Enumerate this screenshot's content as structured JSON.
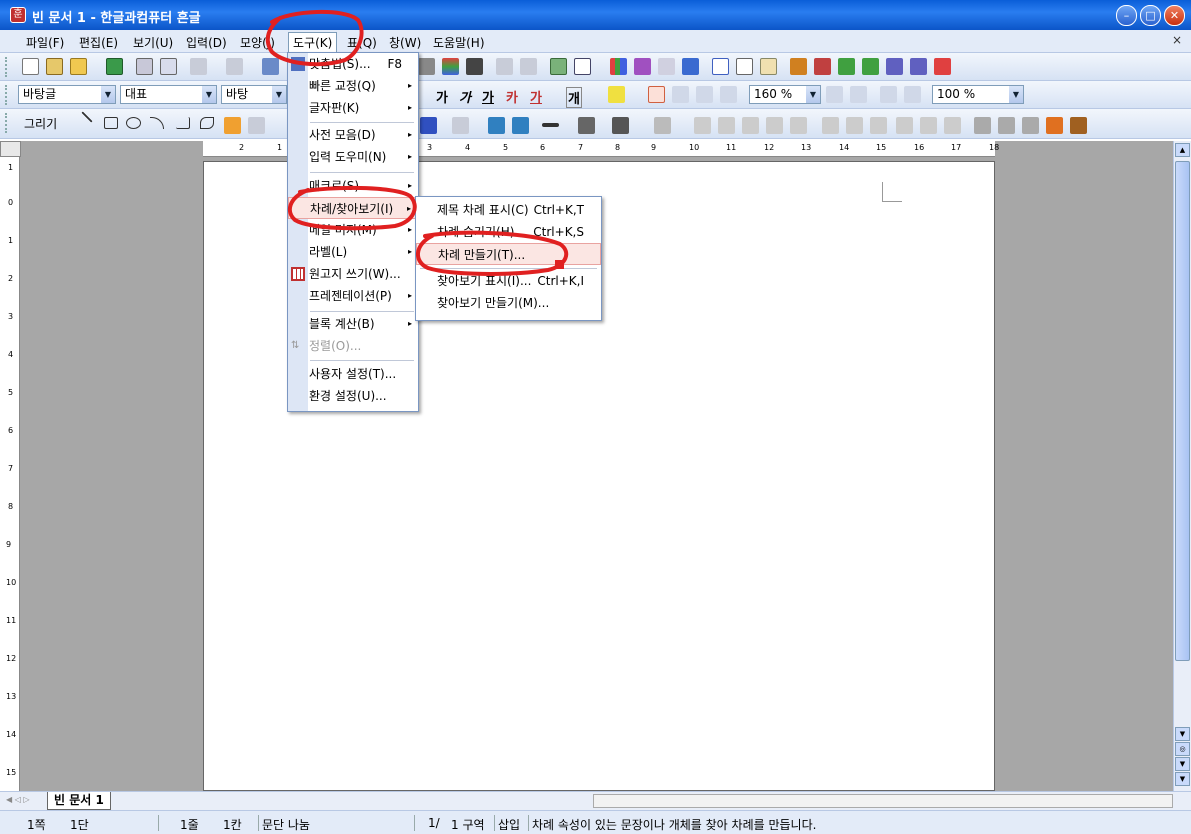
{
  "window": {
    "title": "빈 문서 1 - 한글과컴퓨터 흔글",
    "app_icon": "hancom-icon"
  },
  "menubar": {
    "items": [
      "파일(F)",
      "편집(E)",
      "보기(U)",
      "입력(D)",
      "모양(J)",
      "도구(K)",
      "표(Q)",
      "창(W)",
      "도움말(H)"
    ],
    "active": "도구(K)",
    "close": "×"
  },
  "toolbar2": {
    "style": "바탕글",
    "para": "대표",
    "font": "바탕",
    "line_spacing": "160 %",
    "zoom": "100 %"
  },
  "toolbar3": {
    "draw_label": "그리기"
  },
  "tools_menu": {
    "items": [
      {
        "label": "맞춤법(S)...",
        "shortcut": "F8"
      },
      {
        "label": "빠른 교정(Q)",
        "sub": "▸"
      },
      {
        "label": "글자판(K)",
        "sub": "▸"
      },
      {
        "label": "사전 모음(D)",
        "sub": "▸"
      },
      {
        "label": "입력 도우미(N)",
        "sub": "▸"
      },
      {
        "label": "매크로(S)",
        "sub": "▸"
      },
      {
        "label": "차례/찾아보기(I)",
        "sub": "▸"
      },
      {
        "label": "메일 머지(M)",
        "sub": "▸"
      },
      {
        "label": "라벨(L)",
        "sub": "▸"
      },
      {
        "label": "원고지 쓰기(W)..."
      },
      {
        "label": "프레젠테이션(P)",
        "sub": "▸"
      },
      {
        "label": "블록 계산(B)",
        "sub": "▸"
      },
      {
        "label": "정렬(O)...",
        "disabled": true
      },
      {
        "label": "사용자 설정(T)..."
      },
      {
        "label": "환경 설정(U)..."
      }
    ]
  },
  "sub_menu": {
    "items": [
      {
        "label": "제목 차례 표시(C)",
        "shortcut": "Ctrl+K,T"
      },
      {
        "label": "차례 숨기기(H)",
        "shortcut": "Ctrl+K,S"
      },
      {
        "label": "차례 만들기(T)...",
        "highlighted": true
      },
      {
        "label": "찾아보기 표시(I)...",
        "shortcut": "Ctrl+K,I"
      },
      {
        "label": "찾아보기 만들기(M)..."
      }
    ]
  },
  "tabs": {
    "doc_tab": "빈 문서 1"
  },
  "statusbar": {
    "page": "1쪽",
    "column": "1단",
    "line": "1줄",
    "char": "1칸",
    "break": "문단 나눔",
    "pages": "1/",
    "section": "1 구역",
    "mode": "삽입",
    "message": "차례 속성이 있는 문장이나 개체를 찾아 차례를 만듭니다."
  },
  "ruler": {
    "h_marks": [
      "2",
      "1",
      "1",
      "2",
      "3",
      "4",
      "5",
      "6",
      "7",
      "8",
      "9",
      "10",
      "11",
      "12",
      "13",
      "14",
      "15",
      "16",
      "17",
      "18"
    ],
    "v_marks": [
      "1",
      "0",
      "1",
      "2",
      "3",
      "4",
      "5",
      "6",
      "7",
      "8",
      "9",
      "10",
      "11",
      "12",
      "13",
      "14",
      "15"
    ]
  },
  "colors": {
    "titlebar": "#0a5ed8",
    "annotation": "#e02020",
    "highlight": "#fbe6e3"
  }
}
